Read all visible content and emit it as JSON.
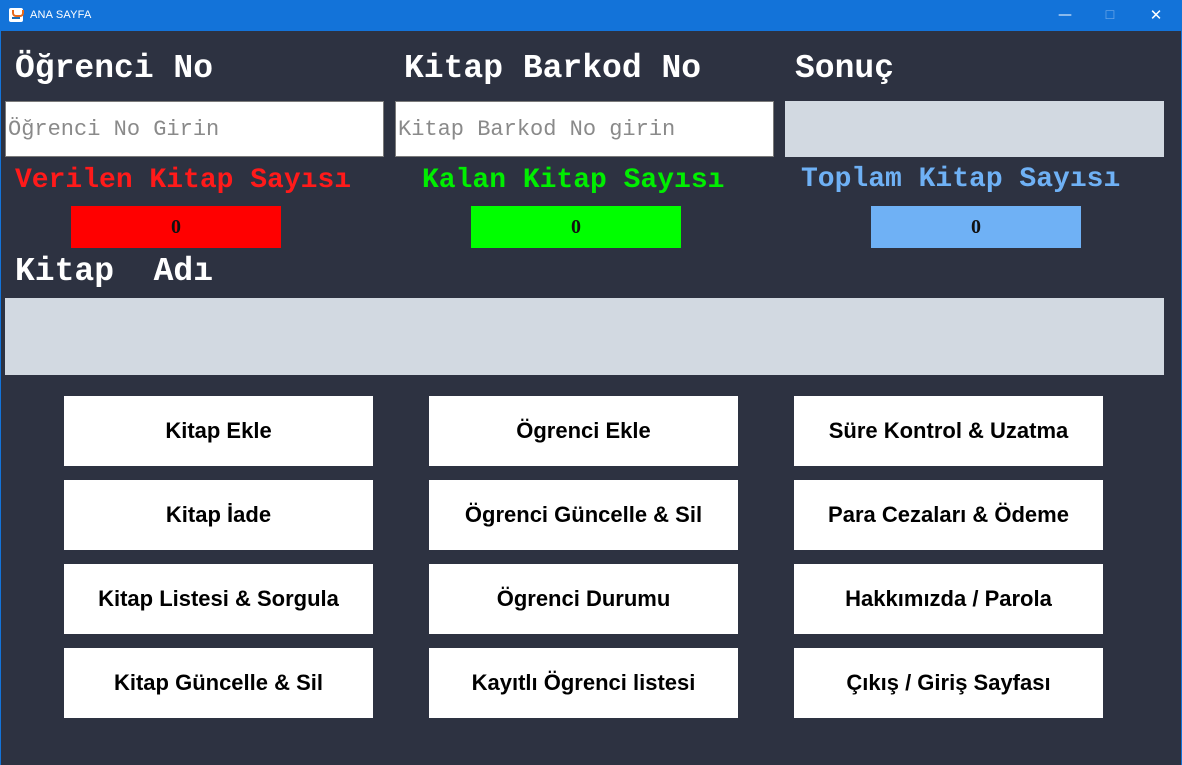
{
  "window": {
    "title": "ANA SAYFA",
    "controls": {
      "minimize": "—",
      "maximize": "☐",
      "close": "✕"
    },
    "icon": "java-cup-icon"
  },
  "headings": {
    "student_no": "Öğrenci No",
    "book_barcode": "Kitap Barkod No",
    "result": "Sonuç",
    "book_name": "Kitap  Adı"
  },
  "inputs": {
    "student_no": {
      "value": "",
      "placeholder": "Öğrenci No Girin"
    },
    "book_barcode": {
      "value": "",
      "placeholder": "Kitap Barkod No girin"
    },
    "result": {
      "value": ""
    },
    "book_name": {
      "value": ""
    }
  },
  "stats": {
    "given": {
      "label": "Verilen Kitap Sayısı",
      "value": "0",
      "label_color": "#ff1a1a",
      "box_color": "#ff0000"
    },
    "remaining": {
      "label": "Kalan Kitap Sayısı",
      "value": "0",
      "label_color": "#00ee00",
      "box_color": "#00ff00"
    },
    "total": {
      "label": "Toplam Kitap Sayısı",
      "value": "0",
      "label_color": "#6fb1f5",
      "box_color": "#6fb1f5"
    }
  },
  "buttons": {
    "col1": [
      "Kitap Ekle",
      "Kitap İade",
      "Kitap Listesi & Sorgula",
      "Kitap Güncelle & Sil"
    ],
    "col2": [
      "Ögrenci Ekle",
      "Ögrenci Güncelle & Sil",
      "Ögrenci Durumu",
      "Kayıtlı Ögrenci listesi"
    ],
    "col3": [
      "Süre Kontrol & Uzatma",
      "Para Cezaları & Ödeme",
      "Hakkımızda / Parola",
      "Çıkış / Giriş Sayfası"
    ]
  },
  "colors": {
    "background": "#2d3241",
    "titlebar": "#1373d9",
    "readonly_field": "#d2d9e1"
  }
}
